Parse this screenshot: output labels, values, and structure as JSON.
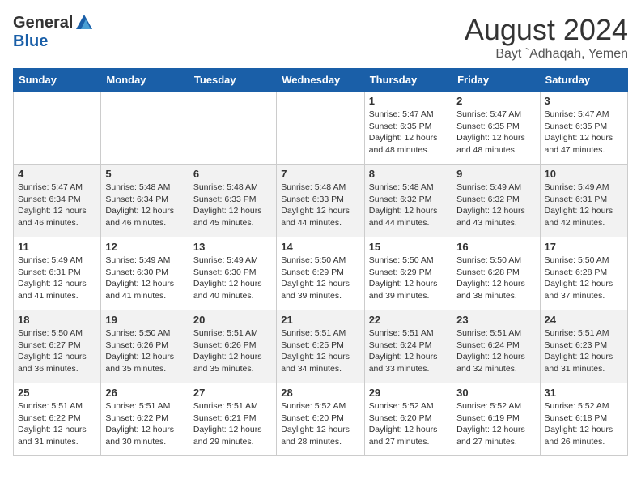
{
  "header": {
    "logo_general": "General",
    "logo_blue": "Blue",
    "month_title": "August 2024",
    "location": "Bayt `Adhaqah, Yemen"
  },
  "days_of_week": [
    "Sunday",
    "Monday",
    "Tuesday",
    "Wednesday",
    "Thursday",
    "Friday",
    "Saturday"
  ],
  "weeks": [
    [
      {
        "day": "",
        "info": ""
      },
      {
        "day": "",
        "info": ""
      },
      {
        "day": "",
        "info": ""
      },
      {
        "day": "",
        "info": ""
      },
      {
        "day": "1",
        "info": "Sunrise: 5:47 AM\nSunset: 6:35 PM\nDaylight: 12 hours\nand 48 minutes."
      },
      {
        "day": "2",
        "info": "Sunrise: 5:47 AM\nSunset: 6:35 PM\nDaylight: 12 hours\nand 48 minutes."
      },
      {
        "day": "3",
        "info": "Sunrise: 5:47 AM\nSunset: 6:35 PM\nDaylight: 12 hours\nand 47 minutes."
      }
    ],
    [
      {
        "day": "4",
        "info": "Sunrise: 5:47 AM\nSunset: 6:34 PM\nDaylight: 12 hours\nand 46 minutes."
      },
      {
        "day": "5",
        "info": "Sunrise: 5:48 AM\nSunset: 6:34 PM\nDaylight: 12 hours\nand 46 minutes."
      },
      {
        "day": "6",
        "info": "Sunrise: 5:48 AM\nSunset: 6:33 PM\nDaylight: 12 hours\nand 45 minutes."
      },
      {
        "day": "7",
        "info": "Sunrise: 5:48 AM\nSunset: 6:33 PM\nDaylight: 12 hours\nand 44 minutes."
      },
      {
        "day": "8",
        "info": "Sunrise: 5:48 AM\nSunset: 6:32 PM\nDaylight: 12 hours\nand 44 minutes."
      },
      {
        "day": "9",
        "info": "Sunrise: 5:49 AM\nSunset: 6:32 PM\nDaylight: 12 hours\nand 43 minutes."
      },
      {
        "day": "10",
        "info": "Sunrise: 5:49 AM\nSunset: 6:31 PM\nDaylight: 12 hours\nand 42 minutes."
      }
    ],
    [
      {
        "day": "11",
        "info": "Sunrise: 5:49 AM\nSunset: 6:31 PM\nDaylight: 12 hours\nand 41 minutes."
      },
      {
        "day": "12",
        "info": "Sunrise: 5:49 AM\nSunset: 6:30 PM\nDaylight: 12 hours\nand 41 minutes."
      },
      {
        "day": "13",
        "info": "Sunrise: 5:49 AM\nSunset: 6:30 PM\nDaylight: 12 hours\nand 40 minutes."
      },
      {
        "day": "14",
        "info": "Sunrise: 5:50 AM\nSunset: 6:29 PM\nDaylight: 12 hours\nand 39 minutes."
      },
      {
        "day": "15",
        "info": "Sunrise: 5:50 AM\nSunset: 6:29 PM\nDaylight: 12 hours\nand 39 minutes."
      },
      {
        "day": "16",
        "info": "Sunrise: 5:50 AM\nSunset: 6:28 PM\nDaylight: 12 hours\nand 38 minutes."
      },
      {
        "day": "17",
        "info": "Sunrise: 5:50 AM\nSunset: 6:28 PM\nDaylight: 12 hours\nand 37 minutes."
      }
    ],
    [
      {
        "day": "18",
        "info": "Sunrise: 5:50 AM\nSunset: 6:27 PM\nDaylight: 12 hours\nand 36 minutes."
      },
      {
        "day": "19",
        "info": "Sunrise: 5:50 AM\nSunset: 6:26 PM\nDaylight: 12 hours\nand 35 minutes."
      },
      {
        "day": "20",
        "info": "Sunrise: 5:51 AM\nSunset: 6:26 PM\nDaylight: 12 hours\nand 35 minutes."
      },
      {
        "day": "21",
        "info": "Sunrise: 5:51 AM\nSunset: 6:25 PM\nDaylight: 12 hours\nand 34 minutes."
      },
      {
        "day": "22",
        "info": "Sunrise: 5:51 AM\nSunset: 6:24 PM\nDaylight: 12 hours\nand 33 minutes."
      },
      {
        "day": "23",
        "info": "Sunrise: 5:51 AM\nSunset: 6:24 PM\nDaylight: 12 hours\nand 32 minutes."
      },
      {
        "day": "24",
        "info": "Sunrise: 5:51 AM\nSunset: 6:23 PM\nDaylight: 12 hours\nand 31 minutes."
      }
    ],
    [
      {
        "day": "25",
        "info": "Sunrise: 5:51 AM\nSunset: 6:22 PM\nDaylight: 12 hours\nand 31 minutes."
      },
      {
        "day": "26",
        "info": "Sunrise: 5:51 AM\nSunset: 6:22 PM\nDaylight: 12 hours\nand 30 minutes."
      },
      {
        "day": "27",
        "info": "Sunrise: 5:51 AM\nSunset: 6:21 PM\nDaylight: 12 hours\nand 29 minutes."
      },
      {
        "day": "28",
        "info": "Sunrise: 5:52 AM\nSunset: 6:20 PM\nDaylight: 12 hours\nand 28 minutes."
      },
      {
        "day": "29",
        "info": "Sunrise: 5:52 AM\nSunset: 6:20 PM\nDaylight: 12 hours\nand 27 minutes."
      },
      {
        "day": "30",
        "info": "Sunrise: 5:52 AM\nSunset: 6:19 PM\nDaylight: 12 hours\nand 27 minutes."
      },
      {
        "day": "31",
        "info": "Sunrise: 5:52 AM\nSunset: 6:18 PM\nDaylight: 12 hours\nand 26 minutes."
      }
    ]
  ]
}
